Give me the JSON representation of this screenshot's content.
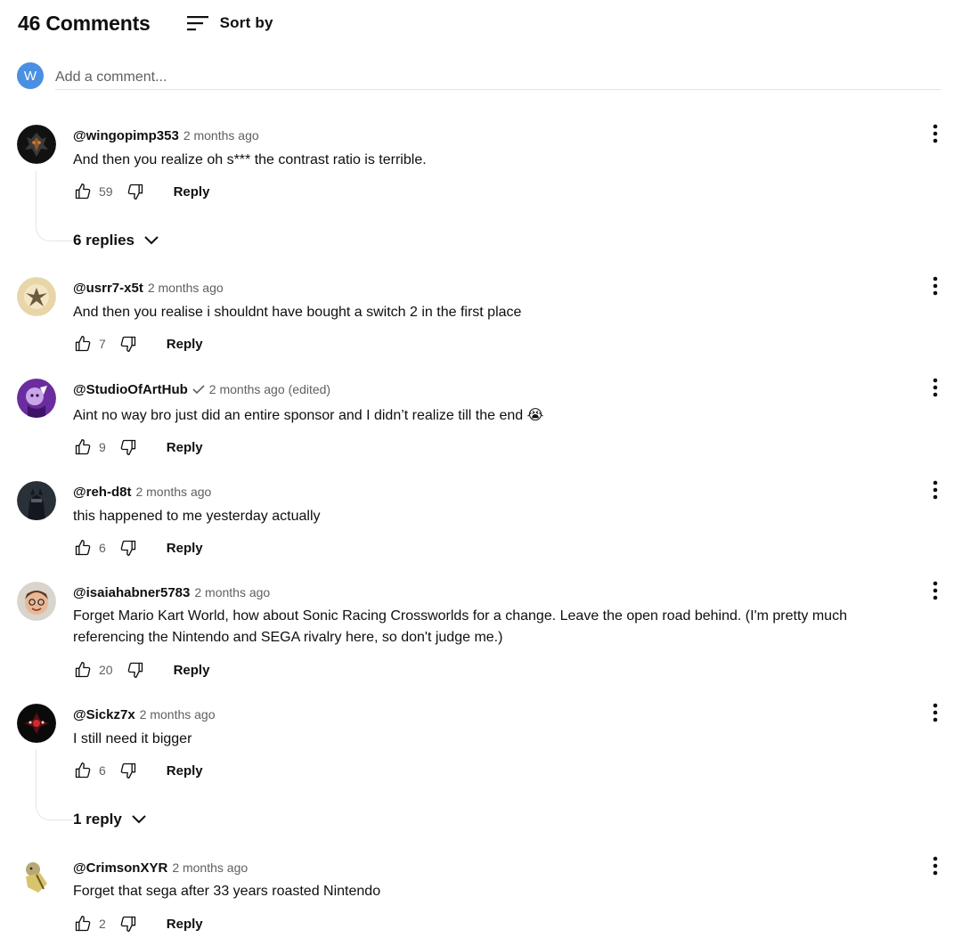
{
  "header": {
    "count_label": "46 Comments",
    "sort_label": "Sort by"
  },
  "add_comment": {
    "avatar_letter": "W",
    "placeholder": "Add a comment..."
  },
  "labels": {
    "reply": "Reply"
  },
  "colors": {
    "avatar_w_bg": "#4a90e2",
    "meta_gray": "#606060",
    "divider": "#e5e5e5"
  },
  "comments": [
    {
      "author": "@wingopimp353",
      "time": "2 months ago",
      "text": "And then you realize oh s*** the contrast ratio is terrible.",
      "likes": "59",
      "replies_label": "6 replies"
    },
    {
      "author": "@usrr7-x5t",
      "time": "2 months ago",
      "text": "And then you realise i shouldnt have bought a switch 2 in the first place",
      "likes": "7"
    },
    {
      "author": "@StudioOfArtHub",
      "verified": true,
      "time": "2 months ago",
      "edited": "(edited)",
      "text": "Aint no way bro just did an entire sponsor and I didn’t realize till the end 😭",
      "likes": "9"
    },
    {
      "author": "@reh-d8t",
      "time": "2 months ago",
      "text": "this happened to me yesterday actually",
      "likes": "6"
    },
    {
      "author": "@isaiahabner5783",
      "time": "2 months ago",
      "text": "Forget Mario Kart World, how about Sonic Racing Crossworlds for a change. Leave the open road behind. (I'm pretty much referencing the Nintendo and SEGA rivalry here, so don't judge me.)",
      "likes": "20"
    },
    {
      "author": "@Sickz7x",
      "time": "2 months ago",
      "text": "I still need it bigger",
      "likes": "6",
      "replies_label": "1 reply"
    },
    {
      "author": "@CrimsonXYR",
      "time": "2 months ago",
      "text": "Forget that sega after 33 years roasted Nintendo",
      "likes": "2"
    }
  ]
}
